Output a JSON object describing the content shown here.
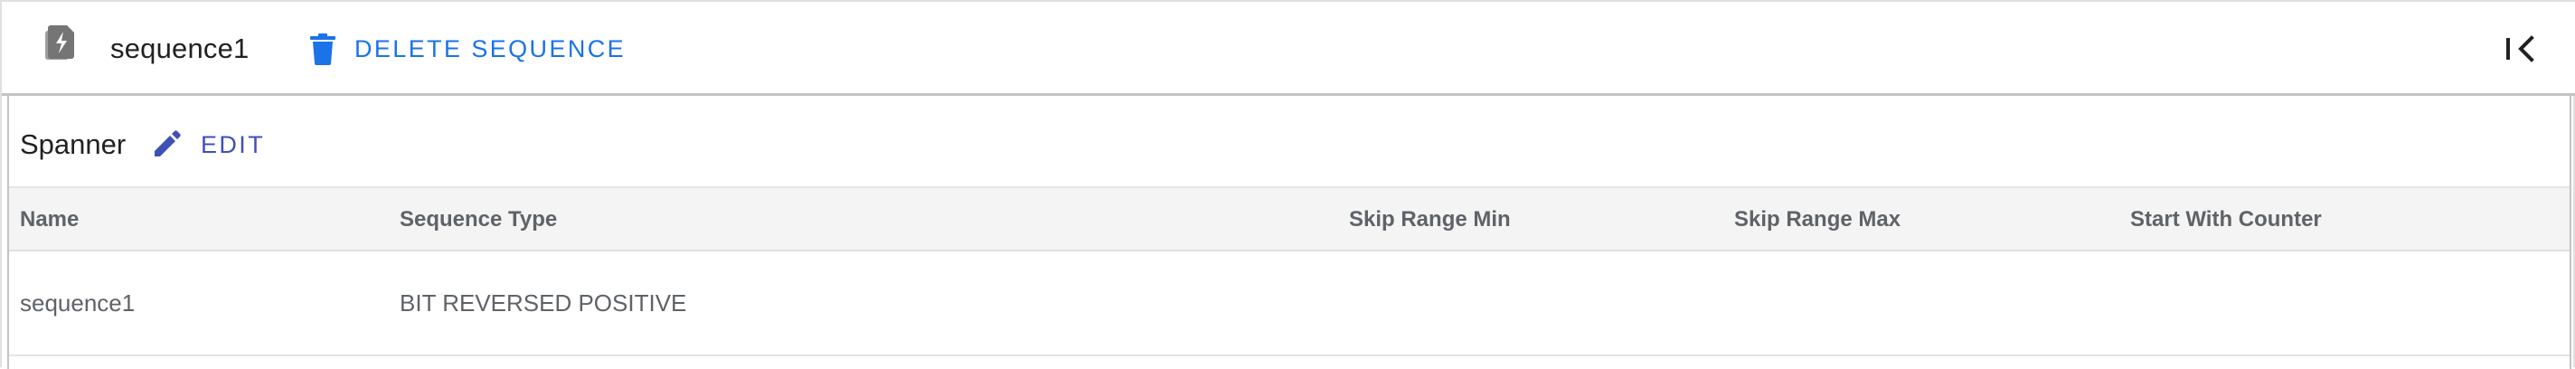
{
  "header": {
    "icon": "sequence-icon",
    "title": "sequence1",
    "delete_icon": "trash-icon",
    "delete_label": "DELETE SEQUENCE",
    "collapse_icon": "collapse-left-icon"
  },
  "card": {
    "title": "Spanner",
    "edit_icon": "pencil-icon",
    "edit_label": "EDIT"
  },
  "table": {
    "columns": [
      "Name",
      "Sequence Type",
      "Skip Range Min",
      "Skip Range Max",
      "Start With Counter"
    ],
    "rows": [
      {
        "name": "sequence1",
        "sequence_type": "BIT REVERSED POSITIVE",
        "skip_range_min": "",
        "skip_range_max": "",
        "start_with_counter": ""
      }
    ]
  },
  "colors": {
    "accent_blue": "#1a73e8",
    "edit_indigo": "#3f51b5",
    "header_bg": "#f4f4f4",
    "muted_text": "#5f6368"
  }
}
